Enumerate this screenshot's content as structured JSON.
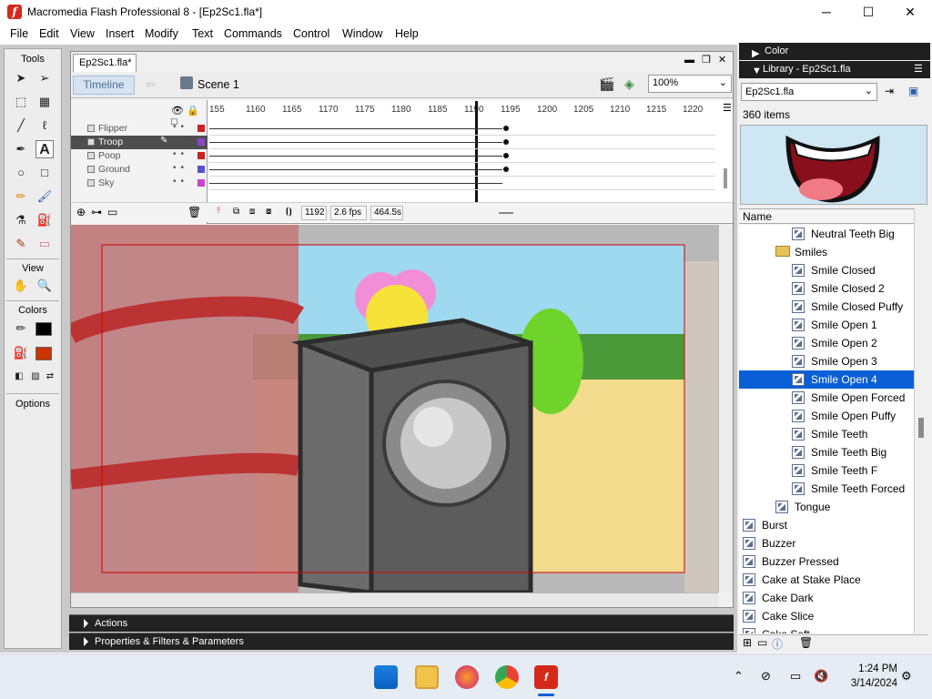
{
  "window": {
    "title": "Macromedia Flash Professional 8 - [Ep2Sc1.fla*]",
    "app_icon": "f",
    "minimize": "─",
    "maximize": "☐",
    "close": "✕"
  },
  "menu": [
    "File",
    "Edit",
    "View",
    "Insert",
    "Modify",
    "Text",
    "Commands",
    "Control",
    "Window",
    "Help"
  ],
  "tools": {
    "title": "Tools",
    "view_label": "View",
    "colors_label": "Colors",
    "options_label": "Options",
    "stroke_color": "#000000",
    "fill_color": "#cc3300"
  },
  "document": {
    "tab": "Ep2Sc1.fla*",
    "timeline_button": "Timeline",
    "scene": "Scene 1",
    "zoom": "100%"
  },
  "timeline": {
    "ruler": [
      "155",
      "1160",
      "1165",
      "1170",
      "1175",
      "1180",
      "1185",
      "1190",
      "1195",
      "1200",
      "1205",
      "1210",
      "1215",
      "1220"
    ],
    "layers": [
      {
        "name": "Flipper",
        "color": "#cc2222",
        "selected": false
      },
      {
        "name": "Troop",
        "color": "#8844cc",
        "selected": true
      },
      {
        "name": "Poop",
        "color": "#cc2222",
        "selected": false
      },
      {
        "name": "Ground",
        "color": "#5555cc",
        "selected": false
      },
      {
        "name": "Sky",
        "color": "#cc44cc",
        "selected": false
      }
    ],
    "current_frame": "1192",
    "fps": "2.6 fps",
    "elapsed": "464.5s"
  },
  "panels": {
    "actions": "Actions",
    "properties": "Properties & Filters & Parameters"
  },
  "right": {
    "color_panel": "Color",
    "library_panel": "Library - Ep2Sc1.fla",
    "library_file": "Ep2Sc1.fla",
    "item_count": "360 items",
    "name_header": "Name"
  },
  "library": [
    {
      "name": "Neutral Teeth Big",
      "type": "symbol",
      "indent": 2
    },
    {
      "name": "Smiles",
      "type": "folder",
      "indent": 1
    },
    {
      "name": "Smile Closed",
      "type": "symbol",
      "indent": 2
    },
    {
      "name": "Smile Closed 2",
      "type": "symbol",
      "indent": 2
    },
    {
      "name": "Smile Closed Puffy",
      "type": "symbol",
      "indent": 2
    },
    {
      "name": "Smile Open 1",
      "type": "symbol",
      "indent": 2
    },
    {
      "name": "Smile Open 2",
      "type": "symbol",
      "indent": 2
    },
    {
      "name": "Smile Open 3",
      "type": "symbol",
      "indent": 2
    },
    {
      "name": "Smile Open 4",
      "type": "symbol",
      "indent": 2,
      "selected": true
    },
    {
      "name": "Smile Open Forced",
      "type": "symbol",
      "indent": 2
    },
    {
      "name": "Smile Open Puffy",
      "type": "symbol",
      "indent": 2
    },
    {
      "name": "Smile Teeth",
      "type": "symbol",
      "indent": 2
    },
    {
      "name": "Smile Teeth Big",
      "type": "symbol",
      "indent": 2
    },
    {
      "name": "Smile Teeth F",
      "type": "symbol",
      "indent": 2
    },
    {
      "name": "Smile Teeth Forced",
      "type": "symbol",
      "indent": 2
    },
    {
      "name": "Tongue",
      "type": "symbol",
      "indent": 1
    },
    {
      "name": "Burst",
      "type": "symbol",
      "indent": 0
    },
    {
      "name": "Buzzer",
      "type": "symbol",
      "indent": 0
    },
    {
      "name": "Buzzer Pressed",
      "type": "symbol",
      "indent": 0
    },
    {
      "name": "Cake at Stake Place",
      "type": "symbol",
      "indent": 0
    },
    {
      "name": "Cake Dark",
      "type": "symbol",
      "indent": 0
    },
    {
      "name": "Cake Slice",
      "type": "symbol",
      "indent": 0
    },
    {
      "name": "Cake Soft",
      "type": "symbol",
      "indent": 0
    }
  ],
  "taskbar": {
    "time": "1:24 PM",
    "date": "3/14/2024"
  }
}
